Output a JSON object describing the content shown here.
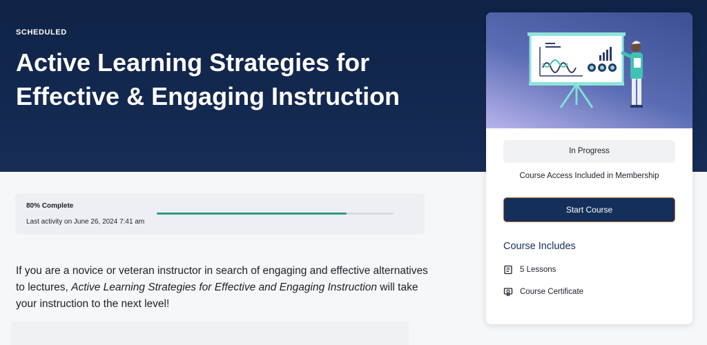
{
  "hero": {
    "eyebrow": "SCHEDULED",
    "title": "Active Learning Strategies for Effective & Engaging Instruction"
  },
  "progress": {
    "percent_label": "80% Complete",
    "activity": "Last activity on June 26, 2024 7:41 am",
    "fraction": 0.8
  },
  "description": {
    "before": "If you are a novice or veteran instructor in search of engaging and effective alternatives to lectures, ",
    "course_name": "Active Learning Strategies for Effective and Engaging Instruction",
    "after": " will take your instruction to the next level!"
  },
  "sidebar": {
    "status": "In Progress",
    "access": "Course Access Included in Membership",
    "start_button": "Start Course",
    "includes_title": "Course Includes",
    "includes": [
      {
        "icon": "book-icon",
        "label": "5 Lessons"
      },
      {
        "icon": "certificate-icon",
        "label": "Course Certificate"
      }
    ]
  },
  "colors": {
    "hero_bg": "#0f2347",
    "accent": "#14305a",
    "progress": "#2a9b8a"
  }
}
